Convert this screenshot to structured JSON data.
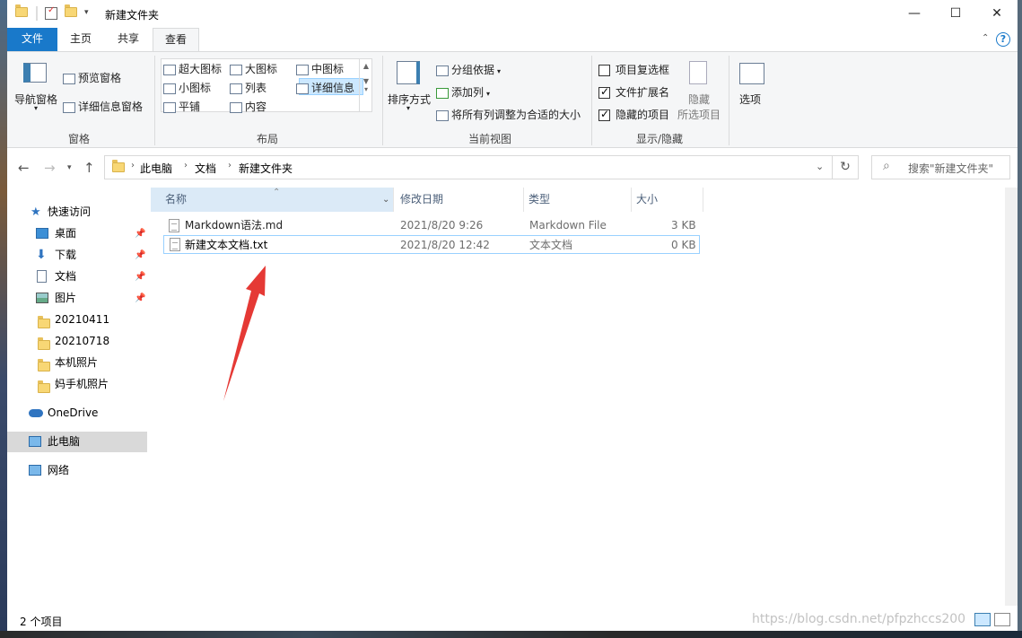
{
  "window": {
    "title": "新建文件夹"
  },
  "ribbon_tabs": [
    "文件",
    "主页",
    "共享",
    "查看"
  ],
  "ribbon": {
    "pane_group": {
      "nav_pane": "导航窗格",
      "preview_pane": "预览窗格",
      "details_pane": "详细信息窗格",
      "label": "窗格"
    },
    "layout_group": {
      "items": [
        "超大图标",
        "大图标",
        "中图标",
        "小图标",
        "列表",
        "详细信息",
        "平铺",
        "内容"
      ],
      "selected": "详细信息",
      "label": "布局"
    },
    "current_view_group": {
      "sort_by": "排序方式",
      "group_by": "分组依据",
      "add_column": "添加列",
      "size_all_columns": "将所有列调整为合适的大小",
      "label": "当前视图"
    },
    "show_hide_group": {
      "item_checkboxes": {
        "label": "项目复选框",
        "checked": false
      },
      "file_extensions": {
        "label": "文件扩展名",
        "checked": true
      },
      "hidden_items": {
        "label": "隐藏的项目",
        "checked": true
      },
      "hide_selected_line1": "隐藏",
      "hide_selected_line2": "所选项目",
      "label": "显示/隐藏"
    },
    "options": "选项"
  },
  "address": {
    "crumbs": [
      "此电脑",
      "文档",
      "新建文件夹"
    ]
  },
  "search": {
    "placeholder": "搜索\"新建文件夹\""
  },
  "nav_pane": {
    "quick_access": "快速访问",
    "items": [
      "桌面",
      "下载",
      "文档",
      "图片",
      "20210411",
      "20210718",
      "本机照片",
      "妈手机照片"
    ],
    "onedrive": "OneDrive",
    "this_pc": "此电脑",
    "network": "网络"
  },
  "columns": [
    "名称",
    "修改日期",
    "类型",
    "大小"
  ],
  "files": [
    {
      "name": "Markdown语法.md",
      "modified": "2021/8/20 9:26",
      "type": "Markdown File",
      "size": "3 KB"
    },
    {
      "name": "新建文本文档.txt",
      "modified": "2021/8/20 12:42",
      "type": "文本文档",
      "size": "0 KB"
    }
  ],
  "status": {
    "item_count": "2 个项目"
  },
  "watermark": "https://blog.csdn.net/pfpzhccs200",
  "colors": {
    "file_tab": "#1979ca",
    "selection": "#cce8ff",
    "arrow": "#e53935"
  }
}
